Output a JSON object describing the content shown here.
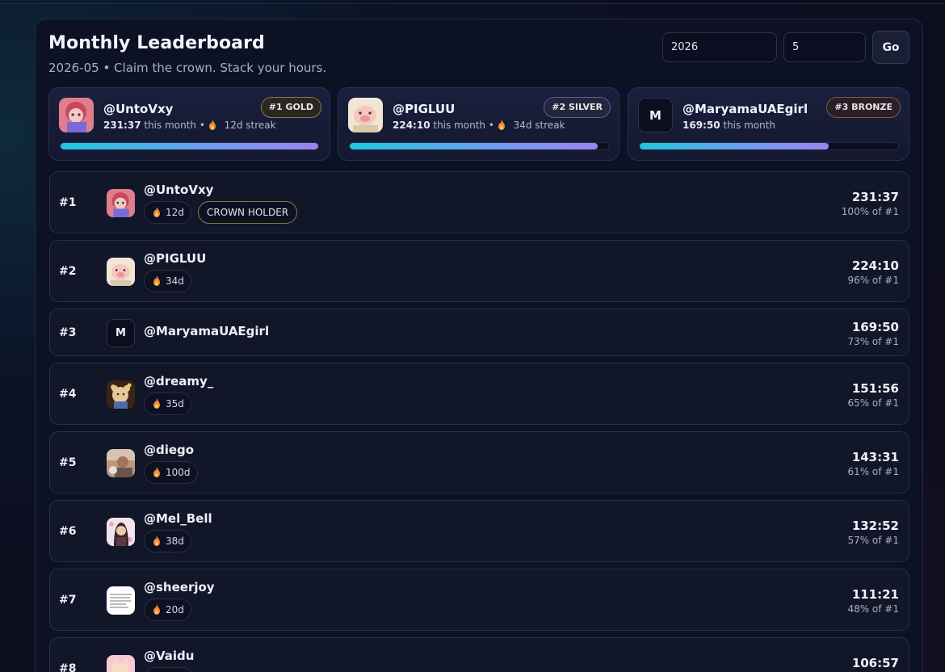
{
  "header": {
    "title": "Monthly Leaderboard",
    "subtitle": "2026-05 • Claim the crown. Stack your hours."
  },
  "controls": {
    "year_value": "2026",
    "month_value": "5",
    "go_label": "Go"
  },
  "podium": [
    {
      "name": "@UntoVxy",
      "hours": "231:37",
      "this_month": "this month •",
      "streak": "12d streak",
      "badge": "#1 GOLD",
      "progress": 1.0,
      "avatar": "pink-character-avatar"
    },
    {
      "name": "@PIGLUU",
      "hours": "224:10",
      "this_month": "this month •",
      "streak": "34d streak",
      "badge": "#2 SILVER",
      "progress": 0.96,
      "avatar": "pig-character-avatar"
    },
    {
      "name": "@MaryamaUAEgirl",
      "hours": "169:50",
      "this_month": "this month",
      "streak": "",
      "badge": "#3 BRONZE",
      "progress": 0.73,
      "avatar_letter": "M"
    }
  ],
  "rows": [
    {
      "rank": "#1",
      "name": "@UntoVxy",
      "streak": "12d",
      "extra": "CROWN HOLDER",
      "hours": "231:37",
      "pct": "100% of #1",
      "avatar": "pink-character-avatar"
    },
    {
      "rank": "#2",
      "name": "@PIGLUU",
      "streak": "34d",
      "hours": "224:10",
      "pct": "96% of #1",
      "avatar": "pig-character-avatar"
    },
    {
      "rank": "#3",
      "name": "@MaryamaUAEgirl",
      "streak": "",
      "hours": "169:50",
      "pct": "73% of #1",
      "avatar_letter": "M"
    },
    {
      "rank": "#4",
      "name": "@dreamy_",
      "streak": "35d",
      "hours": "151:56",
      "pct": "65% of #1",
      "avatar": "teddy-bear-avatar"
    },
    {
      "rank": "#5",
      "name": "@diego",
      "streak": "100d",
      "hours": "143:31",
      "pct": "61% of #1",
      "avatar": "photo-avatar"
    },
    {
      "rank": "#6",
      "name": "@Mel_Bell",
      "streak": "38d",
      "hours": "132:52",
      "pct": "57% of #1",
      "avatar": "portrait-avatar"
    },
    {
      "rank": "#7",
      "name": "@sheerjoy",
      "streak": "20d",
      "hours": "111:21",
      "pct": "48% of #1",
      "avatar": "note-avatar"
    },
    {
      "rank": "#8",
      "name": "@Vaidu",
      "streak": "",
      "hours": "106:57",
      "pct": "",
      "avatar": "cat-avatar"
    }
  ],
  "colors": {
    "accent_gradient_start": "#1ec8e0",
    "accent_gradient_end": "#9a82f0",
    "gold": "#8c7a3f",
    "silver": "#5a6282",
    "bronze": "#8a5548"
  }
}
